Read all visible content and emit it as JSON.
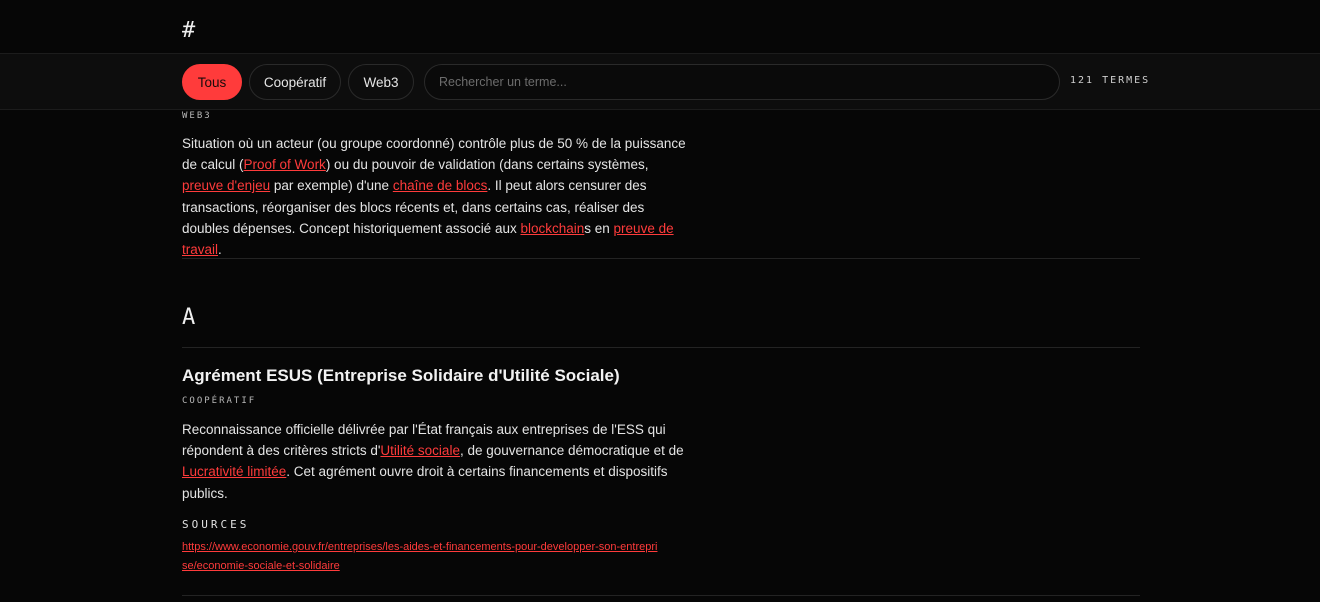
{
  "sections": [
    {
      "letter": "#"
    },
    {
      "letter": "A"
    }
  ],
  "filters": {
    "items": [
      "Tous",
      "Coopératif",
      "Web3"
    ],
    "active": "Tous",
    "search_placeholder": "Rechercher un terme...",
    "count_label": "121 TERMES"
  },
  "term1": {
    "tag": "WEB3",
    "p": {
      "s1": "Situation où un acteur (ou groupe coordonné) contrôle plus de 50 % de la puissance de calcul (",
      "l1": "Proof of Work",
      "s2": ") ou du pouvoir de validation (dans certains systèmes, ",
      "l2": "preuve d'enjeu",
      "s3": " par exemple) d'une ",
      "l3": "chaîne de blocs",
      "s4": ". Il peut alors censurer des transactions, réorganiser des blocs récents et, dans certains cas, réaliser des doubles dépenses. Concept historiquement associé aux ",
      "l4": "blockchain",
      "s5": "s en ",
      "l5": "preuve de travail",
      "s6": "."
    }
  },
  "term2": {
    "title": "Agrément ESUS (Entreprise Solidaire d'Utilité Sociale)",
    "tag": "COOPÉRATIF",
    "p": {
      "s1": "Reconnaissance officielle délivrée par l'État français aux entreprises de l'ESS qui répondent à des critères stricts d'",
      "l1": "Utilité sociale",
      "s2": ", de gouvernance démocratique et de ",
      "l2": "Lucrativité limitée",
      "s3": ". Cet agrément ouvre droit à certains financements et dispositifs publics."
    },
    "sources_label": "SOURCES",
    "source_url": "https://www.economie.gouv.fr/entreprises/les-aides-et-financements-pour-developper-son-entreprise/economie-sociale-et-solidaire"
  }
}
